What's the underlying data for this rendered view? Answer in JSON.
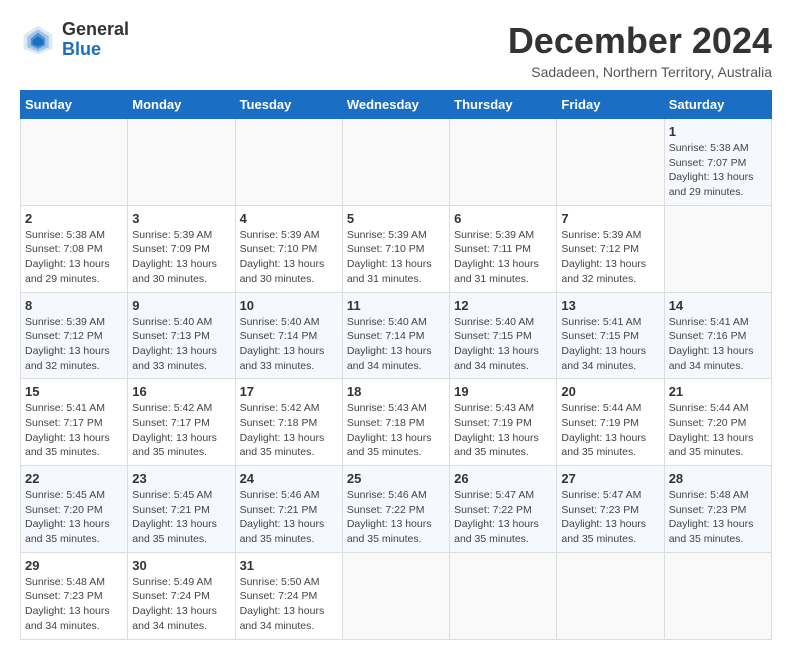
{
  "header": {
    "logo": {
      "general": "General",
      "blue": "Blue"
    },
    "title": "December 2024",
    "subtitle": "Sadadeen, Northern Territory, Australia"
  },
  "calendar": {
    "days_of_week": [
      "Sunday",
      "Monday",
      "Tuesday",
      "Wednesday",
      "Thursday",
      "Friday",
      "Saturday"
    ],
    "weeks": [
      [
        {
          "day": "",
          "info": ""
        },
        {
          "day": "",
          "info": ""
        },
        {
          "day": "",
          "info": ""
        },
        {
          "day": "",
          "info": ""
        },
        {
          "day": "",
          "info": ""
        },
        {
          "day": "",
          "info": ""
        },
        {
          "day": "1",
          "info": "Sunrise: 5:38 AM\nSunset: 7:07 PM\nDaylight: 13 hours\nand 29 minutes."
        }
      ],
      [
        {
          "day": "2",
          "info": "Sunrise: 5:38 AM\nSunset: 7:08 PM\nDaylight: 13 hours\nand 29 minutes."
        },
        {
          "day": "3",
          "info": "Sunrise: 5:39 AM\nSunset: 7:09 PM\nDaylight: 13 hours\nand 30 minutes."
        },
        {
          "day": "4",
          "info": "Sunrise: 5:39 AM\nSunset: 7:10 PM\nDaylight: 13 hours\nand 30 minutes."
        },
        {
          "day": "5",
          "info": "Sunrise: 5:39 AM\nSunset: 7:10 PM\nDaylight: 13 hours\nand 31 minutes."
        },
        {
          "day": "6",
          "info": "Sunrise: 5:39 AM\nSunset: 7:11 PM\nDaylight: 13 hours\nand 31 minutes."
        },
        {
          "day": "7",
          "info": "Sunrise: 5:39 AM\nSunset: 7:12 PM\nDaylight: 13 hours\nand 32 minutes."
        },
        {
          "day": "",
          "info": ""
        }
      ],
      [
        {
          "day": "8",
          "info": "Sunrise: 5:39 AM\nSunset: 7:12 PM\nDaylight: 13 hours\nand 32 minutes."
        },
        {
          "day": "9",
          "info": "Sunrise: 5:40 AM\nSunset: 7:13 PM\nDaylight: 13 hours\nand 33 minutes."
        },
        {
          "day": "10",
          "info": "Sunrise: 5:40 AM\nSunset: 7:14 PM\nDaylight: 13 hours\nand 33 minutes."
        },
        {
          "day": "11",
          "info": "Sunrise: 5:40 AM\nSunset: 7:14 PM\nDaylight: 13 hours\nand 34 minutes."
        },
        {
          "day": "12",
          "info": "Sunrise: 5:40 AM\nSunset: 7:15 PM\nDaylight: 13 hours\nand 34 minutes."
        },
        {
          "day": "13",
          "info": "Sunrise: 5:41 AM\nSunset: 7:15 PM\nDaylight: 13 hours\nand 34 minutes."
        },
        {
          "day": "14",
          "info": "Sunrise: 5:41 AM\nSunset: 7:16 PM\nDaylight: 13 hours\nand 34 minutes."
        }
      ],
      [
        {
          "day": "15",
          "info": "Sunrise: 5:41 AM\nSunset: 7:17 PM\nDaylight: 13 hours\nand 35 minutes."
        },
        {
          "day": "16",
          "info": "Sunrise: 5:42 AM\nSunset: 7:17 PM\nDaylight: 13 hours\nand 35 minutes."
        },
        {
          "day": "17",
          "info": "Sunrise: 5:42 AM\nSunset: 7:18 PM\nDaylight: 13 hours\nand 35 minutes."
        },
        {
          "day": "18",
          "info": "Sunrise: 5:43 AM\nSunset: 7:18 PM\nDaylight: 13 hours\nand 35 minutes."
        },
        {
          "day": "19",
          "info": "Sunrise: 5:43 AM\nSunset: 7:19 PM\nDaylight: 13 hours\nand 35 minutes."
        },
        {
          "day": "20",
          "info": "Sunrise: 5:44 AM\nSunset: 7:19 PM\nDaylight: 13 hours\nand 35 minutes."
        },
        {
          "day": "21",
          "info": "Sunrise: 5:44 AM\nSunset: 7:20 PM\nDaylight: 13 hours\nand 35 minutes."
        }
      ],
      [
        {
          "day": "22",
          "info": "Sunrise: 5:45 AM\nSunset: 7:20 PM\nDaylight: 13 hours\nand 35 minutes."
        },
        {
          "day": "23",
          "info": "Sunrise: 5:45 AM\nSunset: 7:21 PM\nDaylight: 13 hours\nand 35 minutes."
        },
        {
          "day": "24",
          "info": "Sunrise: 5:46 AM\nSunset: 7:21 PM\nDaylight: 13 hours\nand 35 minutes."
        },
        {
          "day": "25",
          "info": "Sunrise: 5:46 AM\nSunset: 7:22 PM\nDaylight: 13 hours\nand 35 minutes."
        },
        {
          "day": "26",
          "info": "Sunrise: 5:47 AM\nSunset: 7:22 PM\nDaylight: 13 hours\nand 35 minutes."
        },
        {
          "day": "27",
          "info": "Sunrise: 5:47 AM\nSunset: 7:23 PM\nDaylight: 13 hours\nand 35 minutes."
        },
        {
          "day": "28",
          "info": "Sunrise: 5:48 AM\nSunset: 7:23 PM\nDaylight: 13 hours\nand 35 minutes."
        }
      ],
      [
        {
          "day": "29",
          "info": "Sunrise: 5:48 AM\nSunset: 7:23 PM\nDaylight: 13 hours\nand 34 minutes."
        },
        {
          "day": "30",
          "info": "Sunrise: 5:49 AM\nSunset: 7:24 PM\nDaylight: 13 hours\nand 34 minutes."
        },
        {
          "day": "31",
          "info": "Sunrise: 5:50 AM\nSunset: 7:24 PM\nDaylight: 13 hours\nand 34 minutes."
        },
        {
          "day": "",
          "info": ""
        },
        {
          "day": "",
          "info": ""
        },
        {
          "day": "",
          "info": ""
        },
        {
          "day": "",
          "info": ""
        }
      ]
    ]
  }
}
